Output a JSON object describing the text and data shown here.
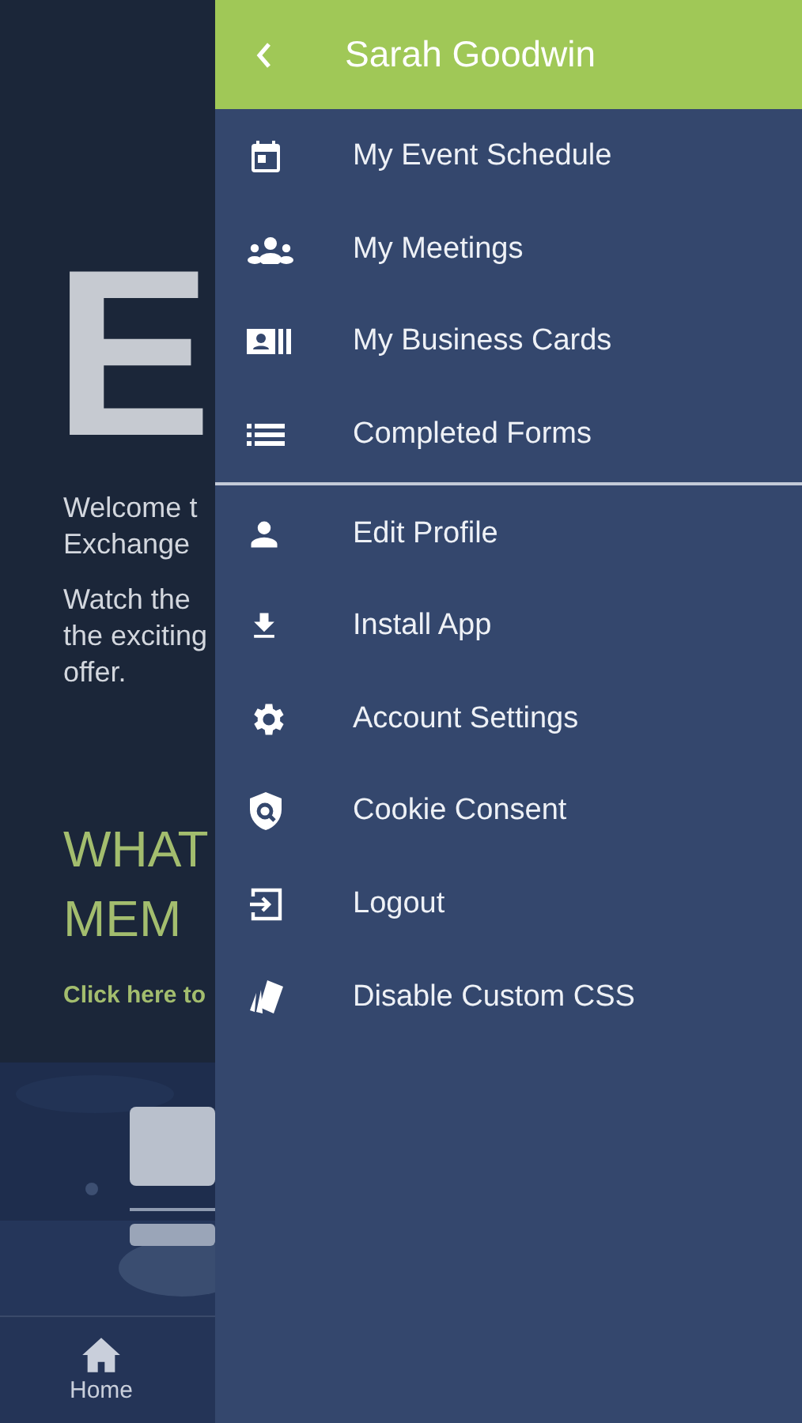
{
  "background_page": {
    "logo_letter": "E",
    "paragraphs": [
      [
        "Welcome t",
        "Exchange"
      ],
      [
        "Watch the",
        "the exciting",
        "offer."
      ]
    ],
    "heading_lines": [
      "WHAT",
      "MEM"
    ],
    "link": "Click here to",
    "banner": {
      "kind": "picture"
    }
  },
  "bottom_nav": [
    {
      "label": "Home",
      "kind": "home"
    }
  ],
  "drawer": {
    "title": "Sarah Goodwin",
    "sections": [
      [
        {
          "label": "My Event Schedule",
          "kind": "calendar"
        },
        {
          "label": "My Meetings",
          "kind": "group"
        },
        {
          "label": "My Business Cards",
          "kind": "card"
        },
        {
          "label": "Completed Forms",
          "kind": "list"
        }
      ],
      [
        {
          "label": "Edit Profile",
          "kind": "person"
        },
        {
          "label": "Install App",
          "kind": "download"
        },
        {
          "label": "Account Settings",
          "kind": "settings"
        },
        {
          "label": "Cookie Consent",
          "kind": "shield"
        },
        {
          "label": "Logout",
          "kind": "logout"
        },
        {
          "label": "Disable Custom CSS",
          "kind": "cards"
        }
      ]
    ]
  }
}
